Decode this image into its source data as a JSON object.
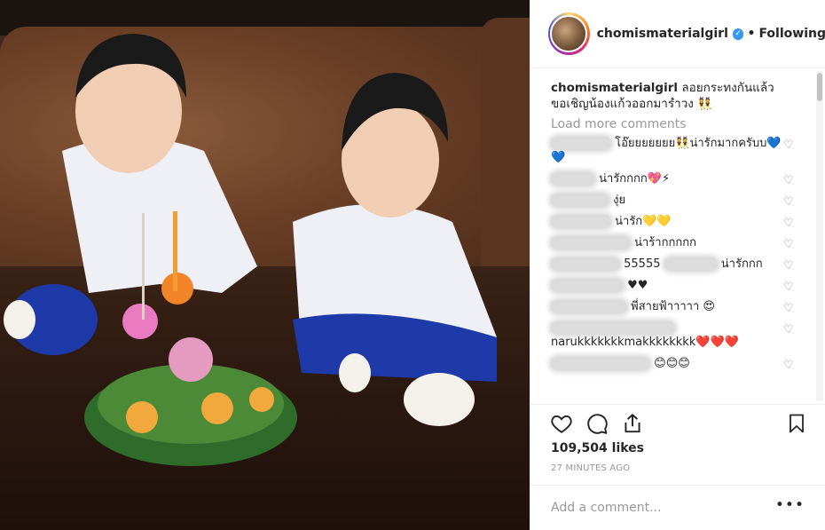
{
  "post": {
    "username": "chomismaterialgirl",
    "verified_icon": "verified-badge-icon",
    "separator": "•",
    "follow_label": "Following"
  },
  "caption": {
    "username": "chomismaterialgirl",
    "text": "ลอยกระทงกันแล้ว ขอเชิญน้องแก้วออกมารำวง 👯"
  },
  "load_more": "Load more comments",
  "comments": [
    {
      "text": "โอ๊ยยยยยยย👯น่ารักมากครับบ💙💙"
    },
    {
      "text": "น่ารักกกก💖⚡"
    },
    {
      "text": "งุ่ย"
    },
    {
      "text": "น่ารัก💛💛"
    },
    {
      "text": "น่าร้ากกกกก"
    },
    {
      "text": "55555",
      "text2": "น่ารักกก"
    },
    {
      "text": "♥♥"
    },
    {
      "text": "พี่สายฟ้าาาาา 😍"
    },
    {
      "text": "narukkkkkkkmakkkkkkkk❤️❤️❤️"
    },
    {
      "text": "😊😊😊"
    }
  ],
  "actions": {
    "like_icon": "heart-icon",
    "comment_icon": "comment-icon",
    "share_icon": "share-icon",
    "save_icon": "bookmark-icon"
  },
  "likes": "109,504 likes",
  "timestamp": "27 MINUTES AGO",
  "add_comment_placeholder": "Add a comment...",
  "more_options": "•••"
}
